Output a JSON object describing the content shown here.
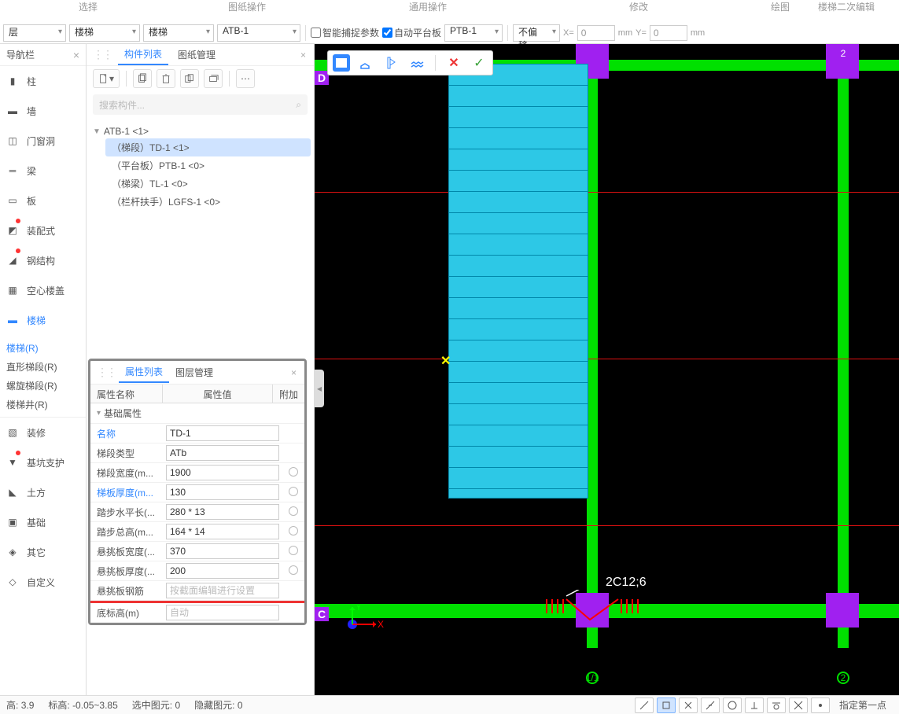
{
  "ribbon": {
    "labels": {
      "select": "选择",
      "drawing_ops": "图纸操作",
      "general_ops": "通用操作",
      "modify": "修改",
      "draw": "绘图",
      "stair_edit": "楼梯二次编辑"
    }
  },
  "topbar": {
    "layer_dd": "层",
    "stair_dd1": "楼梯",
    "stair_dd2": "楼梯",
    "atb_dd": "ATB-1",
    "smart_snap": "智能捕捉参数",
    "auto_platform": "自动平台板",
    "ptb_dd": "PTB-1",
    "offset_dd": "不偏移",
    "x_label": "X=",
    "x_val": "0",
    "y_label": "Y=",
    "y_val": "0",
    "mm": "mm"
  },
  "nav": {
    "title": "导航栏",
    "items": [
      {
        "label": "柱"
      },
      {
        "label": "墙"
      },
      {
        "label": "门窗洞"
      },
      {
        "label": "梁"
      },
      {
        "label": "板"
      },
      {
        "label": "装配式",
        "dot": true
      },
      {
        "label": "钢结构",
        "dot": true
      },
      {
        "label": "空心楼盖"
      },
      {
        "label": "楼梯",
        "active": true
      }
    ],
    "sub": [
      {
        "label": "楼梯(R)",
        "active": true
      },
      {
        "label": "直形梯段(R)"
      },
      {
        "label": "螺旋梯段(R)"
      },
      {
        "label": "楼梯井(R)"
      }
    ],
    "items2": [
      {
        "label": "装修"
      },
      {
        "label": "基坑支护",
        "dot": true
      },
      {
        "label": "土方"
      },
      {
        "label": "基础"
      },
      {
        "label": "其它"
      },
      {
        "label": "自定义"
      }
    ]
  },
  "comp": {
    "tab1": "构件列表",
    "tab2": "图纸管理",
    "search_ph": "搜索构件...",
    "tree_root": "ATB-1 <1>",
    "tree_items": [
      {
        "label": "（梯段）TD-1 <1>",
        "selected": true
      },
      {
        "label": "（平台板）PTB-1 <0>"
      },
      {
        "label": "（梯梁）TL-1 <0>"
      },
      {
        "label": "（栏杆扶手）LGFS-1 <0>"
      }
    ]
  },
  "props": {
    "tab1": "属性列表",
    "tab2": "图层管理",
    "hdr_name": "属性名称",
    "hdr_value": "属性值",
    "hdr_extra": "附加",
    "section": "基础属性",
    "rows": [
      {
        "name": "名称",
        "value": "TD-1",
        "link": true
      },
      {
        "name": "梯段类型",
        "value": "ATb"
      },
      {
        "name": "梯段宽度(m...",
        "value": "1900",
        "radio": true
      },
      {
        "name": "梯板厚度(m...",
        "value": "130",
        "link": true,
        "radio": true
      },
      {
        "name": "踏步水平长(...",
        "value": "280 * 13",
        "radio": true
      },
      {
        "name": "踏步总高(m...",
        "value": "164 * 14",
        "radio": true
      },
      {
        "name": "悬挑板宽度(...",
        "value": "370",
        "radio": true
      },
      {
        "name": "悬挑板厚度(...",
        "value": "200",
        "radio": true
      },
      {
        "name": "悬挑板钢筋",
        "placeholder": "按截面编辑进行设置"
      },
      {
        "name": "底标高(m)",
        "placeholder": "自动"
      }
    ]
  },
  "canvas": {
    "label_d": "D",
    "label_c": "C",
    "label_2t": "2",
    "label_2b": "2",
    "label_1": "1/1",
    "annotation": "2C12;6"
  },
  "status": {
    "height_l": "高:",
    "height_v": "3.9",
    "elev_l": "标高:",
    "elev_v": "-0.05~3.85",
    "sel_l": "选中图元:",
    "sel_v": "0",
    "hid_l": "隐藏图元:",
    "hid_v": "0",
    "prompt": "指定第一点"
  }
}
